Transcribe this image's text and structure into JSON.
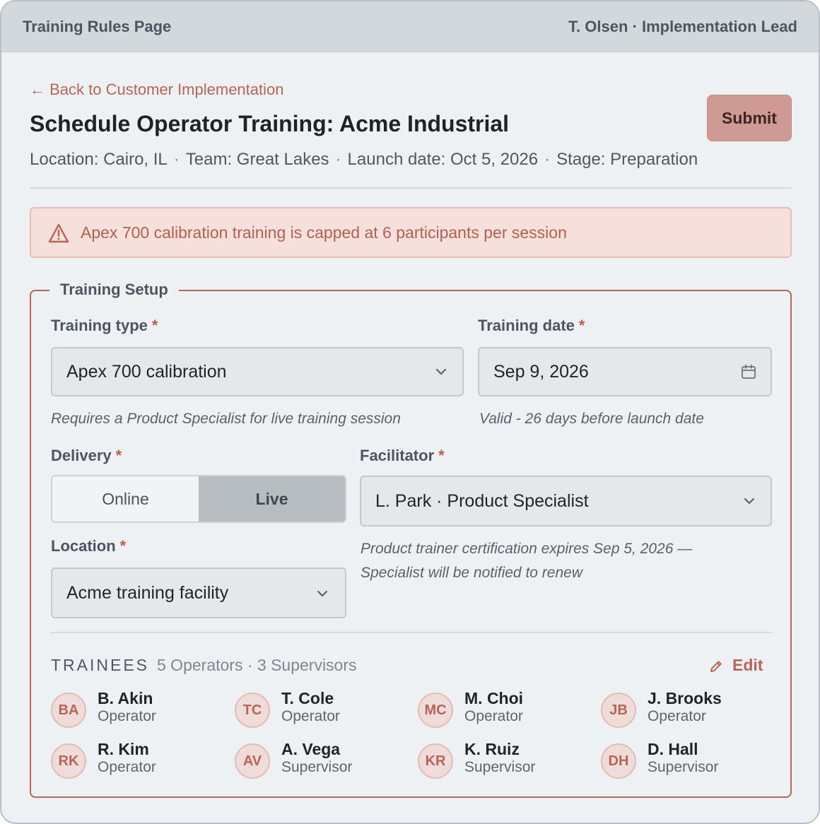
{
  "window": {
    "title": "Training Rules Page",
    "user": "T. Olsen · Implementation Lead"
  },
  "header": {
    "back_link": "← Back to Customer Implementation",
    "title": "Schedule Operator Training: Acme Industrial",
    "submit_label": "Submit",
    "meta": {
      "location": "Location: Cairo, IL",
      "team": "Team: Great Lakes",
      "launch": "Launch date: Oct 5, 2026",
      "stage": "Stage: Preparation",
      "separator": "·"
    }
  },
  "alert": {
    "icon": "warning-icon",
    "text": "Apex 700 calibration training is capped at 6 participants per session"
  },
  "setup": {
    "legend": "Training Setup",
    "required_mark": "*",
    "training_type": {
      "label": "Training type",
      "value": "Apex 700 calibration",
      "hint": "Requires a Product Specialist for live training session"
    },
    "training_date": {
      "label": "Training date",
      "value": "Sep 9, 2026",
      "hint": "Valid - 26 days before launch date"
    },
    "delivery": {
      "label": "Delivery",
      "options": [
        "Online",
        "Live"
      ],
      "selected": "Live"
    },
    "facilitator": {
      "label": "Facilitator",
      "value": "L. Park · Product Specialist",
      "hint_line1": "Product trainer certification expires Sep 5, 2026 —",
      "hint_line2": "Specialist will be notified to renew"
    },
    "location": {
      "label": "Location",
      "value": "Acme training facility"
    }
  },
  "trainees": {
    "heading": "TRAINEES",
    "summary": "5 Operators · 3 Supervisors",
    "edit_label": "Edit",
    "people": [
      {
        "initials": "BA",
        "name": "B. Akin",
        "role": "Operator"
      },
      {
        "initials": "TC",
        "name": "T. Cole",
        "role": "Operator"
      },
      {
        "initials": "MC",
        "name": "M. Choi",
        "role": "Operator"
      },
      {
        "initials": "JB",
        "name": "J. Brooks",
        "role": "Operator"
      },
      {
        "initials": "RK",
        "name": "R. Kim",
        "role": "Operator"
      },
      {
        "initials": "AV",
        "name": "A. Vega",
        "role": "Supervisor"
      },
      {
        "initials": "KR",
        "name": "K. Ruiz",
        "role": "Supervisor"
      },
      {
        "initials": "DH",
        "name": "D. Hall",
        "role": "Supervisor"
      }
    ]
  },
  "colors": {
    "accent": "#b86457",
    "submit_bg": "#cf9a94",
    "alert_bg": "#f5e0db",
    "page_bg": "#eef1f4"
  }
}
